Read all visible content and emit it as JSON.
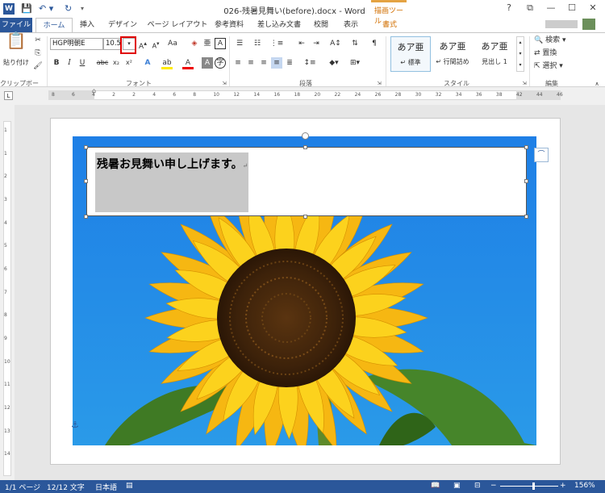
{
  "window": {
    "title": "026-残暑見舞い(before).docx - Word",
    "contextual_group": "描画ツール",
    "controls": [
      "?",
      "⧉",
      "—",
      "☐",
      "✕"
    ]
  },
  "tabs": [
    {
      "label": "ファイル"
    },
    {
      "label": "ホーム"
    },
    {
      "label": "挿入"
    },
    {
      "label": "デザイン"
    },
    {
      "label": "ページ レイアウト"
    },
    {
      "label": "参考資料"
    },
    {
      "label": "差し込み文書"
    },
    {
      "label": "校閲"
    },
    {
      "label": "表示"
    },
    {
      "label": "書式"
    }
  ],
  "ribbon": {
    "clipboard": {
      "paste_label": "貼り付け",
      "group_label": "クリップボード"
    },
    "font": {
      "font_name": "HGP明朝E",
      "font_size": "10.5",
      "group_label": "フォント",
      "aa_label": "Aa",
      "buttons": [
        "B",
        "I",
        "U",
        "abc",
        "x₂",
        "x²"
      ]
    },
    "paragraph": {
      "group_label": "段落"
    },
    "styles": {
      "group_label": "スタイル",
      "items": [
        {
          "sample": "あア亜",
          "name": "↵ 標準"
        },
        {
          "sample": "あア亜",
          "name": "↵ 行間詰め"
        },
        {
          "sample": "あア亜",
          "name": "見出し 1"
        }
      ]
    },
    "editing": {
      "group_label": "編集",
      "items": [
        "検索 ▾",
        "置換",
        "選択 ▾"
      ]
    }
  },
  "ruler": {
    "h_ticks": [
      "8",
      "6",
      "4",
      "2",
      "2",
      "4",
      "6",
      "8",
      "10",
      "12",
      "14",
      "16",
      "18",
      "20",
      "22",
      "24",
      "26",
      "28",
      "30",
      "32",
      "34",
      "36",
      "38",
      "42",
      "44",
      "46"
    ],
    "v_ticks": [
      "1",
      "1",
      "2",
      "3",
      "4",
      "5",
      "6",
      "7",
      "8",
      "9",
      "10",
      "11",
      "12",
      "13",
      "14"
    ]
  },
  "document": {
    "textbox_text": "残暑お見舞い申し上げます。",
    "paragraph_mark": "↵"
  },
  "statusbar": {
    "page": "1/1 ページ",
    "words": "12/12 文字",
    "language": "日本語",
    "zoom": "156%"
  }
}
